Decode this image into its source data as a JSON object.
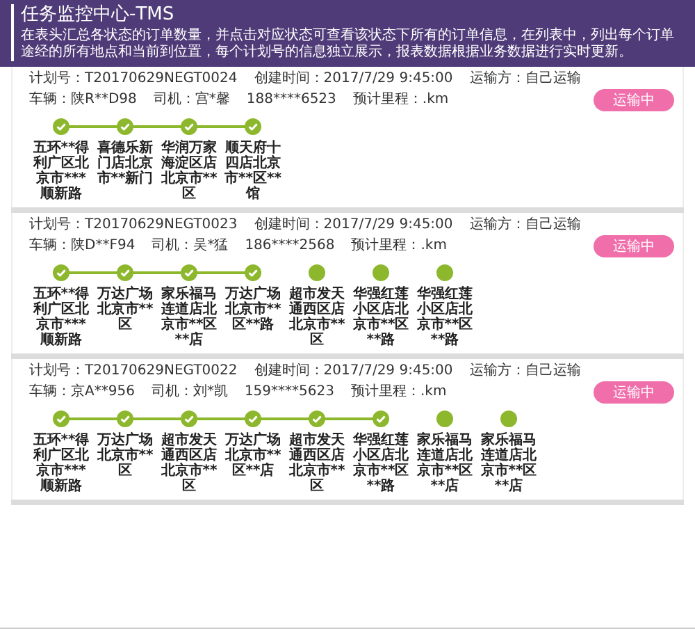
{
  "header": {
    "title": "任务监控中心-TMS",
    "description": "在表头汇总各状态的订单数量，并点击对应状态可查看该状态下所有的订单信息，在列表中，列出每个订单途经的所有地点和当前到位置，每个计划号的信息独立展示，报表数据根据业务数据进行实时更新。"
  },
  "plans": [
    {
      "fields": [
        "计划号：T20170629NEGT0024",
        "创建时间：2017/7/29 9:45:00",
        "运输方：自己运输",
        "车辆：陕R**D98",
        "司机：宫*馨",
        "188****6523",
        "预计里程：.km"
      ],
      "status": "运输中",
      "stops": [
        {
          "name": "五环**得利广区北京市***顺新路",
          "done": true
        },
        {
          "name": "喜德乐新门店北京市**新门",
          "done": true
        },
        {
          "name": "华润万家海淀区店北京市**区",
          "done": true
        },
        {
          "name": "顺天府十四店北京市**区**馆",
          "done": true
        }
      ]
    },
    {
      "fields": [
        "计划号：T20170629NEGT0023",
        "创建时间：2017/7/29 9:45:00",
        "运输方：自己运输",
        "车辆：陕D**F94",
        "司机：吴*猛",
        "186****2568",
        "预计里程：.km"
      ],
      "status": "运输中",
      "stops": [
        {
          "name": "五环**得利广区北京市***顺新路",
          "done": true
        },
        {
          "name": "万达广场北京市**区",
          "done": true
        },
        {
          "name": "家乐福马连道店北京市**区**店",
          "done": true
        },
        {
          "name": "万达广场北京市**区**路",
          "done": true
        },
        {
          "name": "超市发天通西区店北京市**区",
          "done": false
        },
        {
          "name": "华强红莲小区店北京市**区**路",
          "done": false
        },
        {
          "name": "华强红莲小区店北京市**区**路",
          "done": false
        }
      ]
    },
    {
      "fields": [
        "计划号：T20170629NEGT0022",
        "创建时间：2017/7/29 9:45:00",
        "运输方：自己运输",
        "车辆：京A**956",
        "司机：刘*凯",
        "159****5623",
        "预计里程：.km"
      ],
      "status": "运输中",
      "stops": [
        {
          "name": "五环**得利广区北京市***顺新路",
          "done": true
        },
        {
          "name": "万达广场北京市**区",
          "done": true
        },
        {
          "name": "超市发天通西区店北京市**区",
          "done": true
        },
        {
          "name": "万达广场北京市**区**店",
          "done": true
        },
        {
          "name": "超市发天通西区店北京市**区",
          "done": true
        },
        {
          "name": "华强红莲小区店北京市**区**路",
          "done": true
        },
        {
          "name": "家乐福马连道店北京市**区**店",
          "done": false
        },
        {
          "name": "家乐福马连道店北京市**区**店",
          "done": false
        }
      ]
    }
  ]
}
